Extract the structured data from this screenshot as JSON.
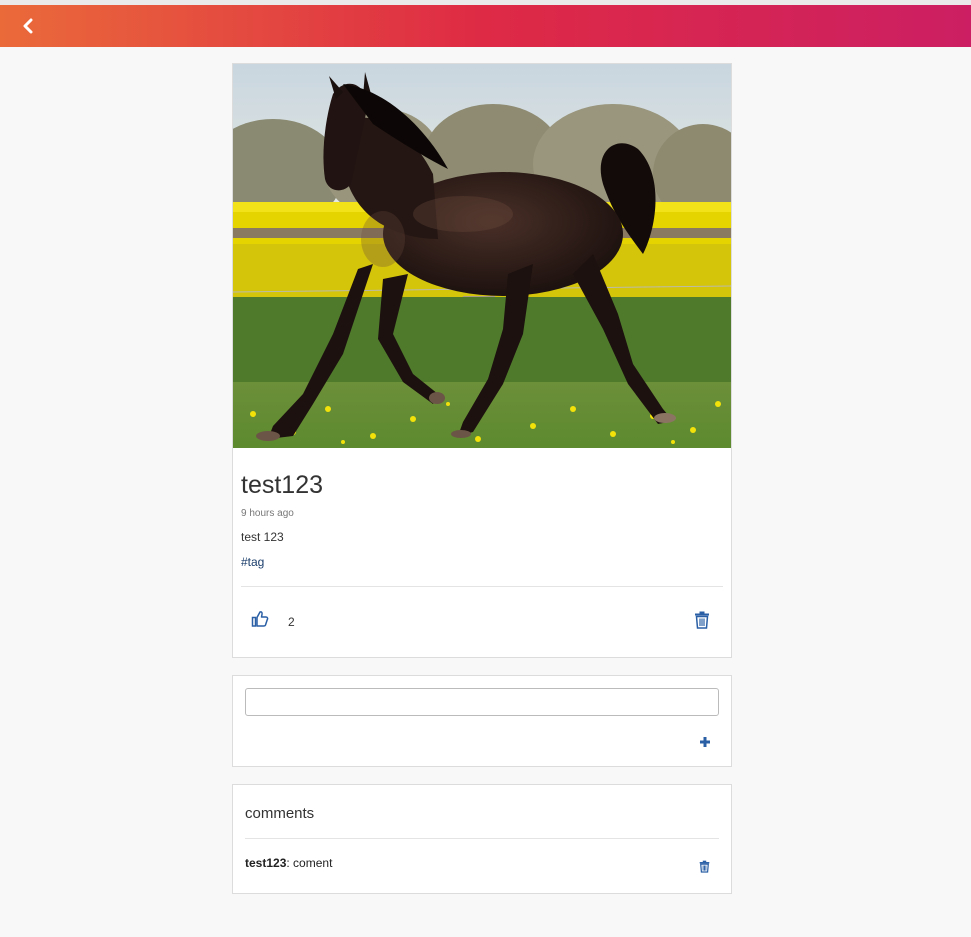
{
  "colors": {
    "navbar_gradient_start": "#ea6a3a",
    "navbar_gradient_mid": "#de2a45",
    "navbar_gradient_end": "#cc1f63",
    "icon_blue": "#2a5fa5"
  },
  "header": {
    "back_icon": "chevron-left-icon"
  },
  "post": {
    "title": "test123",
    "time_ago": "9 hours ago",
    "body": "test 123",
    "tag": "#tag",
    "like_icon": "thumbs-up-icon",
    "like_count": "2",
    "delete_icon": "trash-icon"
  },
  "comment_form": {
    "input_value": "",
    "add_icon": "plus-icon"
  },
  "comments": {
    "heading": "comments",
    "items": [
      {
        "author": "test123",
        "separator": ": ",
        "text": "coment",
        "delete_icon": "trash-icon"
      }
    ]
  }
}
